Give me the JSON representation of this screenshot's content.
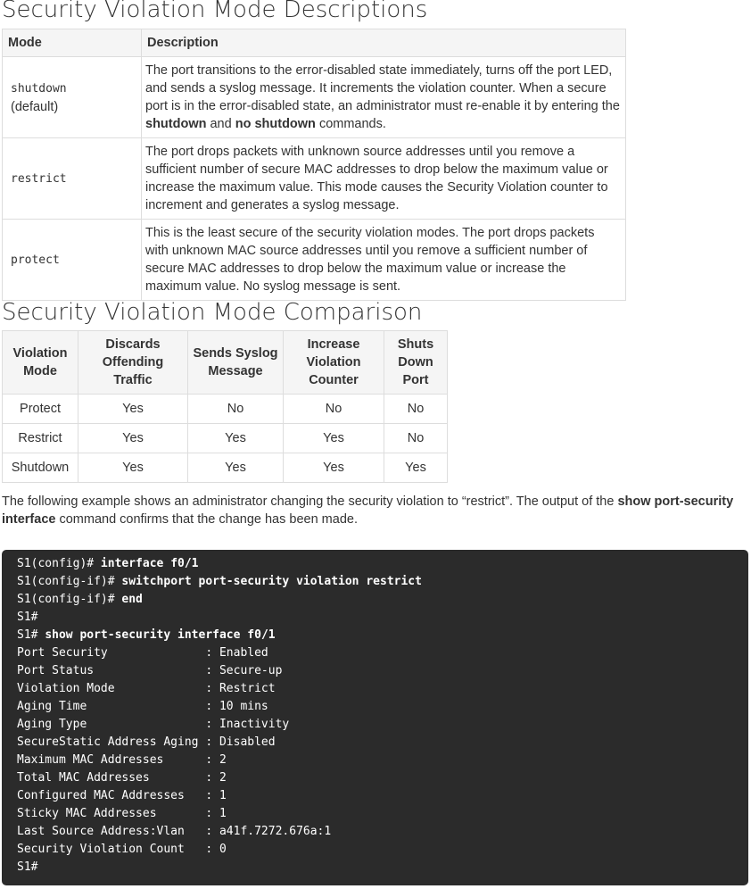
{
  "heading1": "Security Violation Mode Descriptions",
  "table1": {
    "headers": [
      "Mode",
      "Description"
    ],
    "rows": [
      {
        "mode": "shutdown",
        "mode_sub": "(default)",
        "desc_a": "The port transitions to the error-disabled state immediately, turns off the port LED, and sends a syslog message. It increments the violation counter. When a secure port is in the error-disabled state, an administrator must re-enable it by entering the ",
        "desc_b1": "shutdown",
        "desc_mid": " and ",
        "desc_b2": "no shutdown",
        "desc_end": " commands."
      },
      {
        "mode": "restrict",
        "desc": "The port drops packets with unknown source addresses until you remove a sufficient number of secure MAC addresses to drop below the maximum value or increase the maximum value. This mode causes the Security Violation counter to increment and generates a syslog message."
      },
      {
        "mode": "protect",
        "desc": "This is the least secure of the security violation modes. The port drops packets with unknown MAC source addresses until you remove a sufficient number of secure MAC addresses to drop below the maximum value or increase the maximum value. No syslog message is sent."
      }
    ]
  },
  "heading2": "Security Violation Mode Comparison",
  "table2": {
    "headers": [
      "Violation Mode",
      "Discards Offending Traffic",
      "Sends Syslog Message",
      "Increase Violation Counter",
      "Shuts Down Port"
    ],
    "rows": [
      [
        "Protect",
        "Yes",
        "No",
        "No",
        "No"
      ],
      [
        "Restrict",
        "Yes",
        "Yes",
        "Yes",
        "No"
      ],
      [
        "Shutdown",
        "Yes",
        "Yes",
        "Yes",
        "Yes"
      ]
    ]
  },
  "paragraph": {
    "text_a": "The following example shows an administrator changing the security violation to “restrict”. The output of the ",
    "bold": "show port-security interface",
    "text_b": " command confirms that the change has been made."
  },
  "code_lines": [
    {
      "prompt": "S1(config)# ",
      "cmd": "interface f0/1"
    },
    {
      "prompt": "S1(config-if)# ",
      "cmd": "switchport port-security violation restrict"
    },
    {
      "prompt": "S1(config-if)# ",
      "cmd": "end"
    },
    {
      "prompt": "S1#",
      "cmd": ""
    },
    {
      "prompt": "S1# ",
      "cmd": "show port-security interface f0/1"
    },
    {
      "prompt": "Port Security              : Enabled",
      "cmd": ""
    },
    {
      "prompt": "Port Status                : Secure-up",
      "cmd": ""
    },
    {
      "prompt": "Violation Mode             : Restrict",
      "cmd": ""
    },
    {
      "prompt": "Aging Time                 : 10 mins",
      "cmd": ""
    },
    {
      "prompt": "Aging Type                 : Inactivity",
      "cmd": ""
    },
    {
      "prompt": "SecureStatic Address Aging : Disabled",
      "cmd": ""
    },
    {
      "prompt": "Maximum MAC Addresses      : 2",
      "cmd": ""
    },
    {
      "prompt": "Total MAC Addresses        : 2",
      "cmd": ""
    },
    {
      "prompt": "Configured MAC Addresses   : 1",
      "cmd": ""
    },
    {
      "prompt": "Sticky MAC Addresses       : 1",
      "cmd": ""
    },
    {
      "prompt": "Last Source Address:Vlan   : a41f.7272.676a:1",
      "cmd": ""
    },
    {
      "prompt": "Security Violation Count   : 0",
      "cmd": ""
    },
    {
      "prompt": "S1#",
      "cmd": ""
    }
  ]
}
